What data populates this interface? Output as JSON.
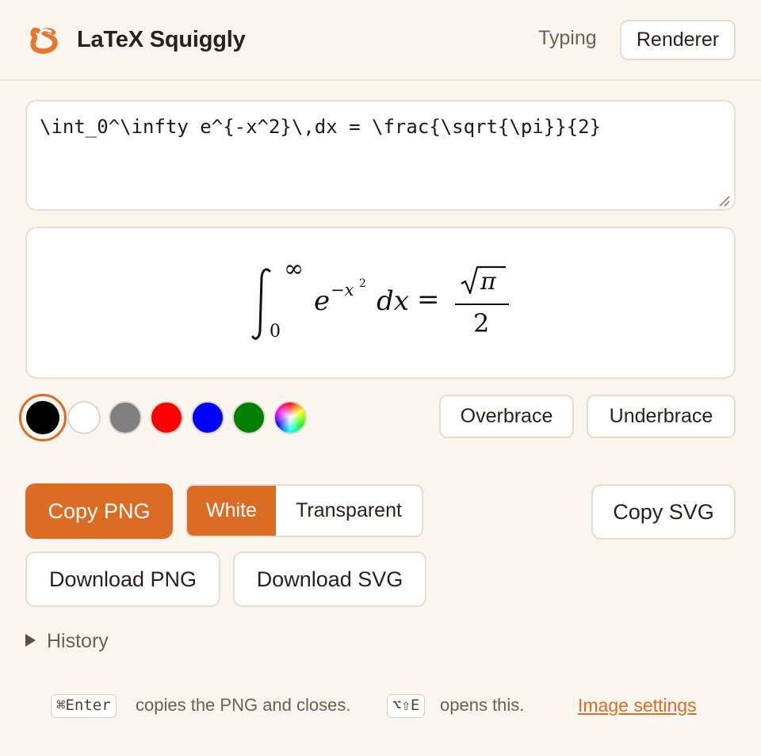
{
  "app": {
    "title": "LaTeX Squiggly"
  },
  "modes": {
    "typing": "Typing",
    "renderer": "Renderer"
  },
  "editor": {
    "value": "\\int_0^\\infty e^{-x^2}\\,dx = \\frac{\\sqrt{\\pi}}{2}"
  },
  "preview": {
    "lower_limit": "0",
    "upper_limit": "∞",
    "base": "e",
    "exp_minus": "−x",
    "exp_power": "2",
    "differential": "dx",
    "equals": "=",
    "numerator": "π",
    "denominator": "2"
  },
  "colors": {
    "accent": "#dc6c24",
    "swatches": [
      "#000000",
      "#ffffff",
      "#808080",
      "#ff0000",
      "#0000ff",
      "#008000",
      "rainbow"
    ]
  },
  "snippets": {
    "overbrace": "Overbrace",
    "underbrace": "Underbrace"
  },
  "actions": {
    "copy_png": "Copy PNG",
    "bg_white": "White",
    "bg_transparent": "Transparent",
    "copy_svg": "Copy SVG",
    "download_png": "Download PNG",
    "download_svg": "Download SVG"
  },
  "history": {
    "label": "History"
  },
  "footer": {
    "kbd_enter": "⌘Enter",
    "text_copies": "copies the PNG and closes.",
    "kbd_open": "⌥⇧E",
    "text_opens": "opens this.",
    "image_settings": "Image settings"
  }
}
